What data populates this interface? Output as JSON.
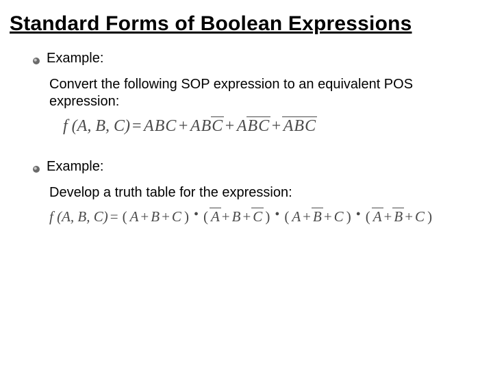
{
  "title": "Standard Forms of Boolean Expressions",
  "sections": [
    {
      "label": "Example:",
      "body": "Convert the following SOP expression to an equivalent POS expression:",
      "formula": {
        "lhs": "f (A, B, C)",
        "type": "SOP",
        "terms": [
          [
            {
              "v": "A",
              "bar": false
            },
            {
              "v": "B",
              "bar": false
            },
            {
              "v": "C",
              "bar": false
            }
          ],
          [
            {
              "v": "A",
              "bar": false
            },
            {
              "v": "B",
              "bar": false
            },
            {
              "v": "C",
              "bar": true
            }
          ],
          [
            {
              "v": "A",
              "bar": false
            },
            {
              "v": "B",
              "bar": true
            },
            {
              "v": "C",
              "bar": true
            }
          ],
          [
            {
              "v": "A",
              "bar": true
            },
            {
              "v": "B",
              "bar": true
            },
            {
              "v": "C",
              "bar": true
            }
          ]
        ]
      }
    },
    {
      "label": "Example:",
      "body": "Develop a truth table for the expression:",
      "formula": {
        "lhs": "f (A, B, C)",
        "type": "POS",
        "terms": [
          [
            {
              "v": "A",
              "bar": false
            },
            {
              "v": "B",
              "bar": false
            },
            {
              "v": "C",
              "bar": false
            }
          ],
          [
            {
              "v": "A",
              "bar": true
            },
            {
              "v": "B",
              "bar": false
            },
            {
              "v": "C",
              "bar": true
            }
          ],
          [
            {
              "v": "A",
              "bar": false
            },
            {
              "v": "B",
              "bar": true
            },
            {
              "v": "C",
              "bar": false
            }
          ],
          [
            {
              "v": "A",
              "bar": true
            },
            {
              "v": "B",
              "bar": true
            },
            {
              "v": "C",
              "bar": false
            }
          ]
        ]
      }
    }
  ]
}
